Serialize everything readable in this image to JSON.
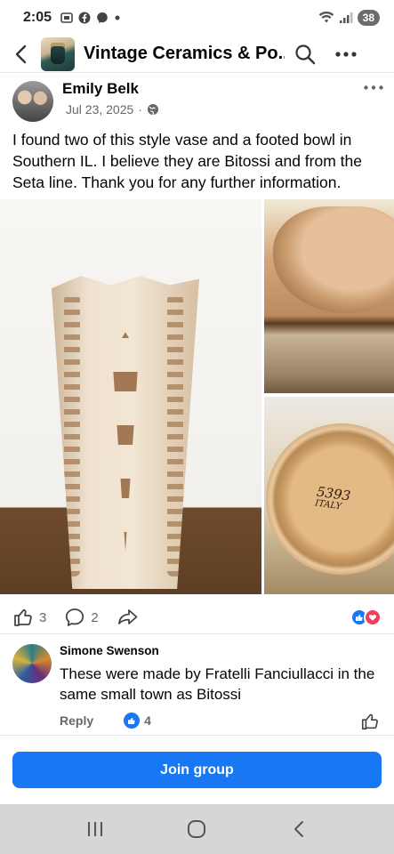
{
  "status_bar": {
    "time": "2:05",
    "left_icons": [
      "screenshot-icon",
      "facebook-icon",
      "messenger-icon",
      "dot-icon"
    ],
    "right_icons": [
      "wifi-icon",
      "signal-icon"
    ],
    "battery": "38"
  },
  "header": {
    "title": "Vintage Ceramics & Po...",
    "icons": [
      "back-arrow-icon",
      "search-icon",
      "more-icon"
    ]
  },
  "post": {
    "author": "Emily Belk",
    "date": "Jul 23, 2025",
    "separator": "·",
    "text": "I found two of this style vase and a footed bowl in Southern IL. I believe they are Bitossi and from the Seta line. Thank you for any further information.",
    "photo_signature_line1": "5393",
    "photo_signature_line2": "ITALY",
    "like_count": "3",
    "comment_count": "2",
    "reactions": [
      "like",
      "love"
    ]
  },
  "comment": {
    "author": "Simone Swenson",
    "text": "These were made by Fratelli Fanciullacci in the same small town as Bitossi",
    "reply_label": "Reply",
    "like_count": "4"
  },
  "join_button": {
    "label": "Join group"
  },
  "nav_bar": {
    "icons": [
      "recents-icon",
      "home-icon",
      "back-icon"
    ]
  },
  "colors": {
    "accent": "#1877f2",
    "love": "#f33e58",
    "secondary_text": "#65676b"
  }
}
